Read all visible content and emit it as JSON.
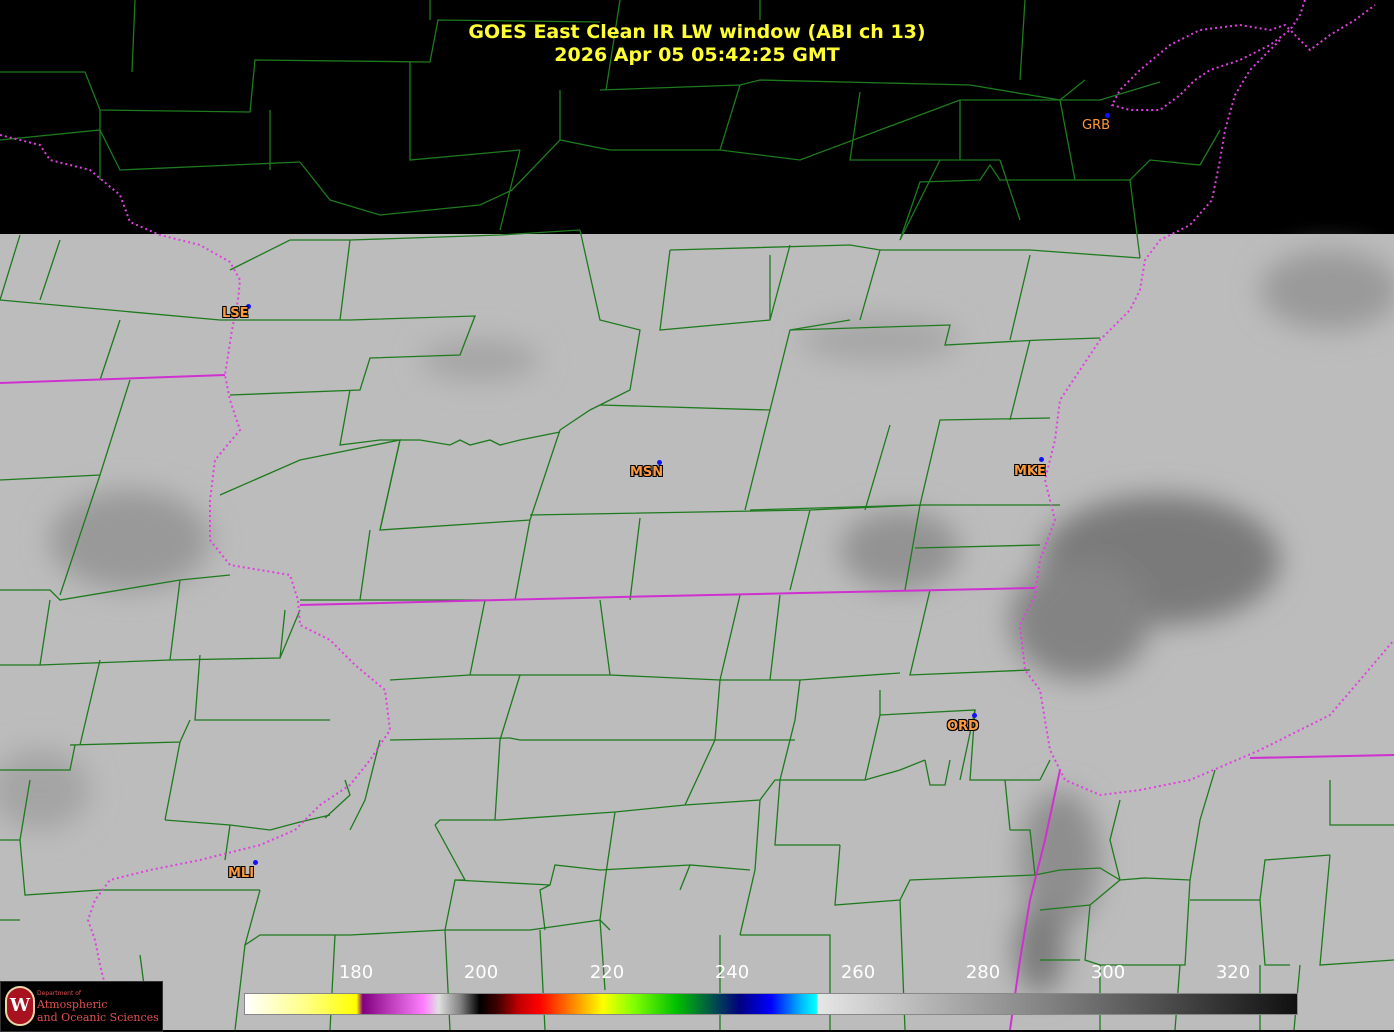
{
  "title_line1": "GOES East Clean IR LW window (ABI ch 13)",
  "title_line2": "2026 Apr 05  05:42:25 GMT",
  "cities": [
    {
      "code": "GRB"
    },
    {
      "code": "LSE"
    },
    {
      "code": "MSN"
    },
    {
      "code": "MKE"
    },
    {
      "code": "ORD"
    },
    {
      "code": "MLI"
    }
  ],
  "colorbar": {
    "tick_labels": [
      "180",
      "200",
      "220",
      "240",
      "260",
      "280",
      "300",
      "320"
    ]
  },
  "logo": {
    "line1": "Department of",
    "line2": "Atmospheric",
    "line3": "and Oceanic Sciences",
    "seal_letter": "W"
  },
  "colors": {
    "title": "#ffff33",
    "county_lines": "#1e7a1e",
    "state_lines": "#e040e0",
    "city_labels": "#ff9a3c",
    "city_dots": "#1010ff",
    "no_data": "#000000",
    "clear_sky": "#bcbcbc"
  }
}
